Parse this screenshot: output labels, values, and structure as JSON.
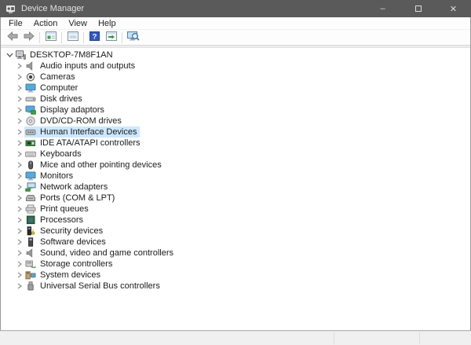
{
  "window": {
    "title": "Device Manager",
    "controls": {
      "minimize": "–",
      "close": "✕"
    }
  },
  "menu": {
    "items": [
      "File",
      "Action",
      "View",
      "Help"
    ]
  },
  "toolbar": {
    "icons": [
      "back-icon",
      "forward-icon",
      "show-hide-console-tree-icon",
      "properties-icon",
      "help-icon",
      "scan-hardware-changes-icon",
      "search-computer-icon"
    ]
  },
  "tree": {
    "root": {
      "label": "DESKTOP-7M8F1AN",
      "icon": "computer-root-icon",
      "expanded": true
    },
    "items": [
      {
        "label": "Audio inputs and outputs",
        "icon": "speaker-icon",
        "selected": false
      },
      {
        "label": "Cameras",
        "icon": "camera-icon",
        "selected": false
      },
      {
        "label": "Computer",
        "icon": "monitor-icon",
        "selected": false
      },
      {
        "label": "Disk drives",
        "icon": "disk-icon",
        "selected": false
      },
      {
        "label": "Display adaptors",
        "icon": "display-adapter-icon",
        "selected": false
      },
      {
        "label": "DVD/CD-ROM drives",
        "icon": "disc-icon",
        "selected": false
      },
      {
        "label": "Human Interface Devices",
        "icon": "hid-icon",
        "selected": true
      },
      {
        "label": "IDE ATA/ATAPI controllers",
        "icon": "ide-icon",
        "selected": false
      },
      {
        "label": "Keyboards",
        "icon": "keyboard-icon",
        "selected": false
      },
      {
        "label": "Mice and other pointing devices",
        "icon": "mouse-icon",
        "selected": false
      },
      {
        "label": "Monitors",
        "icon": "monitor-icon",
        "selected": false
      },
      {
        "label": "Network adapters",
        "icon": "network-icon",
        "selected": false
      },
      {
        "label": "Ports (COM & LPT)",
        "icon": "port-icon",
        "selected": false
      },
      {
        "label": "Print queues",
        "icon": "printer-icon",
        "selected": false
      },
      {
        "label": "Processors",
        "icon": "processor-icon",
        "selected": false
      },
      {
        "label": "Security devices",
        "icon": "security-icon",
        "selected": false
      },
      {
        "label": "Software devices",
        "icon": "software-icon",
        "selected": false
      },
      {
        "label": "Sound, video and game controllers",
        "icon": "sound-icon",
        "selected": false
      },
      {
        "label": "Storage controllers",
        "icon": "storage-icon",
        "selected": false
      },
      {
        "label": "System devices",
        "icon": "system-icon",
        "selected": false
      },
      {
        "label": "Universal Serial Bus controllers",
        "icon": "usb-icon",
        "selected": false
      }
    ]
  },
  "colors": {
    "titlebar": "#5a5a5a",
    "selection": "#cce8ff",
    "help_blue": "#2e58c8",
    "taskbar": "#f0f0f0"
  }
}
